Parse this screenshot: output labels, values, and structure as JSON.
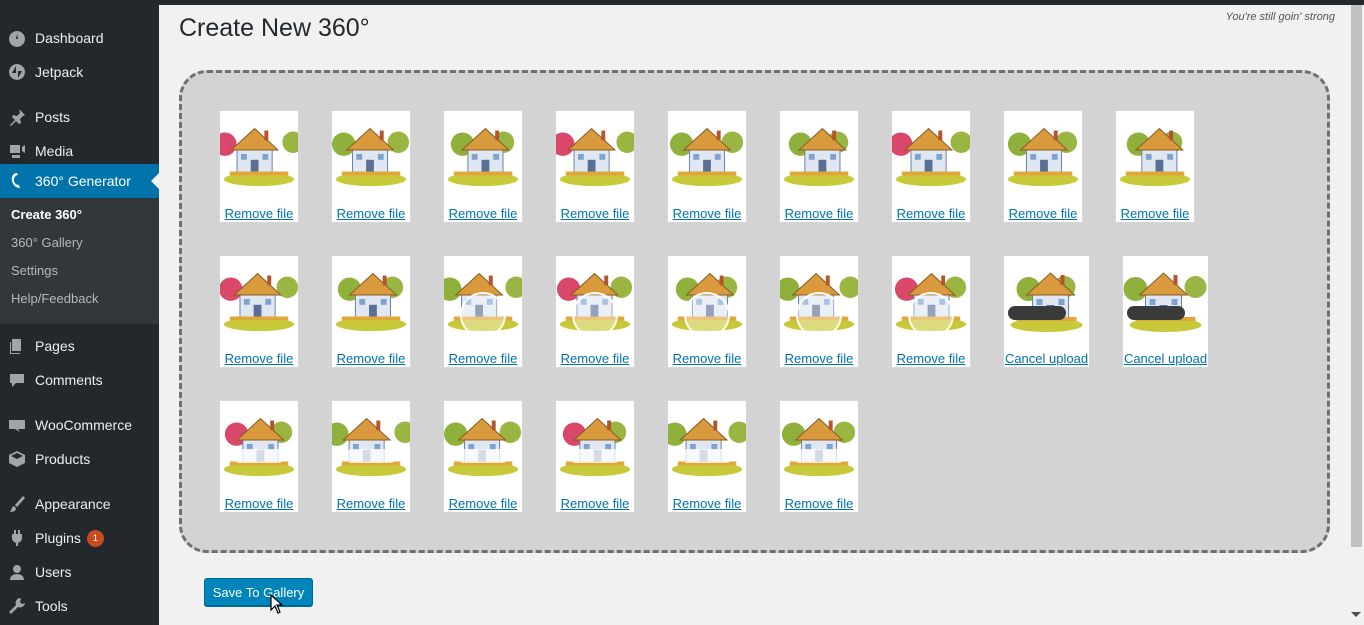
{
  "sidebar": {
    "items": [
      {
        "label": "Dashboard",
        "icon": "dashboard-icon"
      },
      {
        "label": "Jetpack",
        "icon": "jetpack-icon"
      },
      {
        "label": "Posts",
        "icon": "pushpin-icon"
      },
      {
        "label": "Media",
        "icon": "media-icon"
      },
      {
        "label": "360° Generator",
        "icon": "generator-icon"
      },
      {
        "label": "Pages",
        "icon": "pages-icon"
      },
      {
        "label": "Comments",
        "icon": "comment-icon"
      },
      {
        "label": "WooCommerce",
        "icon": "woocommerce-icon"
      },
      {
        "label": "Products",
        "icon": "products-icon"
      },
      {
        "label": "Appearance",
        "icon": "paintbrush-icon"
      },
      {
        "label": "Plugins",
        "icon": "plugin-icon",
        "badge": "1"
      },
      {
        "label": "Users",
        "icon": "user-icon"
      },
      {
        "label": "Tools",
        "icon": "wrench-icon"
      }
    ],
    "submenu": [
      {
        "label": "Create 360°"
      },
      {
        "label": "360° Gallery"
      },
      {
        "label": "Settings"
      },
      {
        "label": "Help/Feedback"
      }
    ]
  },
  "page": {
    "title": "Create New 360°",
    "tagline": "You're still goin' strong"
  },
  "uploads": [
    {
      "link": "Remove file",
      "state": "done"
    },
    {
      "link": "Remove file",
      "state": "done"
    },
    {
      "link": "Remove file",
      "state": "done"
    },
    {
      "link": "Remove file",
      "state": "done"
    },
    {
      "link": "Remove file",
      "state": "done"
    },
    {
      "link": "Remove file",
      "state": "done"
    },
    {
      "link": "Remove file",
      "state": "done"
    },
    {
      "link": "Remove file",
      "state": "done"
    },
    {
      "link": "Remove file",
      "state": "done"
    },
    {
      "link": "Remove file",
      "state": "done"
    },
    {
      "link": "Remove file",
      "state": "done"
    },
    {
      "link": "Remove file",
      "state": "success"
    },
    {
      "link": "Remove file",
      "state": "success"
    },
    {
      "link": "Remove file",
      "state": "success"
    },
    {
      "link": "Remove file",
      "state": "success"
    },
    {
      "link": "Remove file",
      "state": "success"
    },
    {
      "link": "Cancel upload",
      "state": "uploading"
    },
    {
      "link": "Cancel upload",
      "state": "uploading"
    },
    {
      "link": "Remove file",
      "state": "processing"
    },
    {
      "link": "Remove file",
      "state": "processing"
    },
    {
      "link": "Remove file",
      "state": "processing"
    },
    {
      "link": "Remove file",
      "state": "processing"
    },
    {
      "link": "Remove file",
      "state": "processing"
    },
    {
      "link": "Remove file",
      "state": "processing"
    }
  ],
  "actions": {
    "save_label": "Save To Gallery"
  },
  "colors": {
    "sidebar": "#23282d",
    "accent": "#0073aa",
    "button": "#0085ba",
    "badge": "#ca4a1f"
  }
}
